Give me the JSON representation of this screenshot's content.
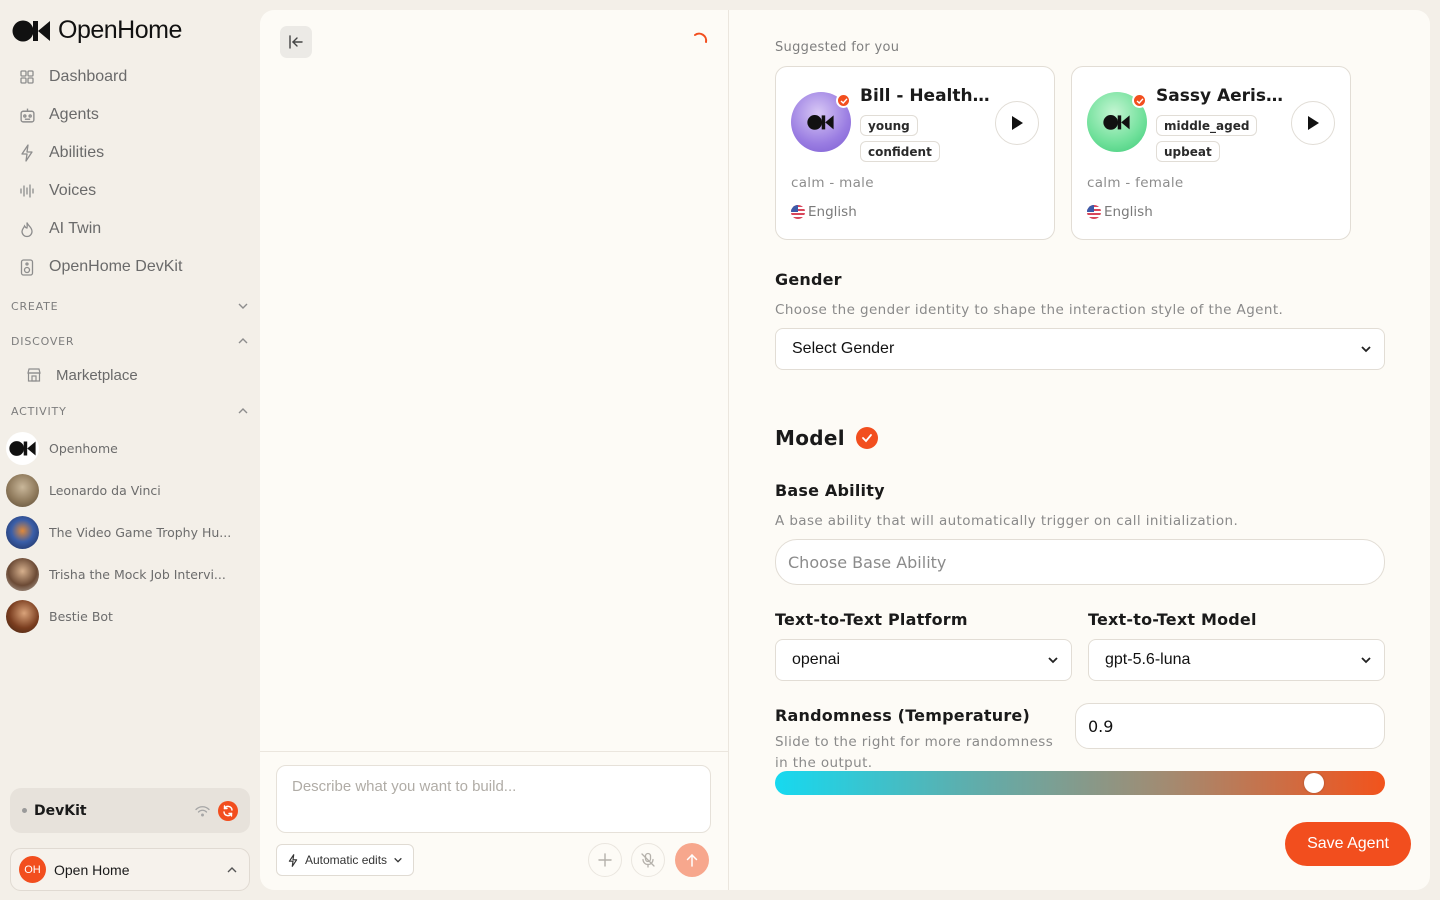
{
  "app": {
    "brand": "OpenHome"
  },
  "sidebar": {
    "nav": [
      {
        "label": "Dashboard",
        "icon": "grid-icon"
      },
      {
        "label": "Agents",
        "icon": "robot-icon"
      },
      {
        "label": "Abilities",
        "icon": "bolt-icon"
      },
      {
        "label": "Voices",
        "icon": "waveform-icon"
      },
      {
        "label": "AI Twin",
        "icon": "flame-icon"
      },
      {
        "label": "OpenHome DevKit",
        "icon": "speaker-icon"
      }
    ],
    "sections": {
      "create": "CREATE",
      "discover": "DISCOVER",
      "activity": "ACTIVITY"
    },
    "discover_items": [
      {
        "label": "Marketplace",
        "icon": "store-icon"
      }
    ],
    "activity_items": [
      {
        "label": "Openhome"
      },
      {
        "label": "Leonardo da Vinci"
      },
      {
        "label": "The Video Game Trophy Hu..."
      },
      {
        "label": "Trisha the Mock Job Intervi..."
      },
      {
        "label": "Bestie Bot"
      }
    ],
    "devkit": {
      "label": "DevKit"
    },
    "user": {
      "initials": "OH",
      "name": "Open Home"
    }
  },
  "chat": {
    "input_placeholder": "Describe what you want to build...",
    "auto_edits_label": "Automatic edits"
  },
  "form": {
    "suggested_label": "Suggested for you",
    "voices": [
      {
        "name": "Bill - Health ...",
        "tags": [
          "young",
          "confident"
        ],
        "description": "calm - male",
        "language": "English"
      },
      {
        "name": "Sassy Aerisi...",
        "tags": [
          "middle_aged",
          "upbeat"
        ],
        "description": "calm - female",
        "language": "English"
      }
    ],
    "gender": {
      "title": "Gender",
      "help": "Choose the gender identity to shape the interaction style of the Agent.",
      "selected": "Select Gender"
    },
    "model": {
      "title": "Model",
      "base_ability": {
        "title": "Base Ability",
        "help": "A base ability that will automatically trigger on call initialization.",
        "placeholder": "Choose Base Ability"
      },
      "platform": {
        "title": "Text-to-Text Platform",
        "selected": "openai"
      },
      "model_select": {
        "title": "Text-to-Text Model",
        "selected": "gpt-5.6-luna"
      },
      "temperature": {
        "title": "Randomness (Temperature)",
        "help": "Slide to the right for more randomness in the output.",
        "value": "0.9",
        "level": 0.9
      }
    },
    "save_label": "Save Agent"
  },
  "colors": {
    "accent": "#f24e1e",
    "panel": "#fdfbf6",
    "background": "#f3efe8"
  }
}
